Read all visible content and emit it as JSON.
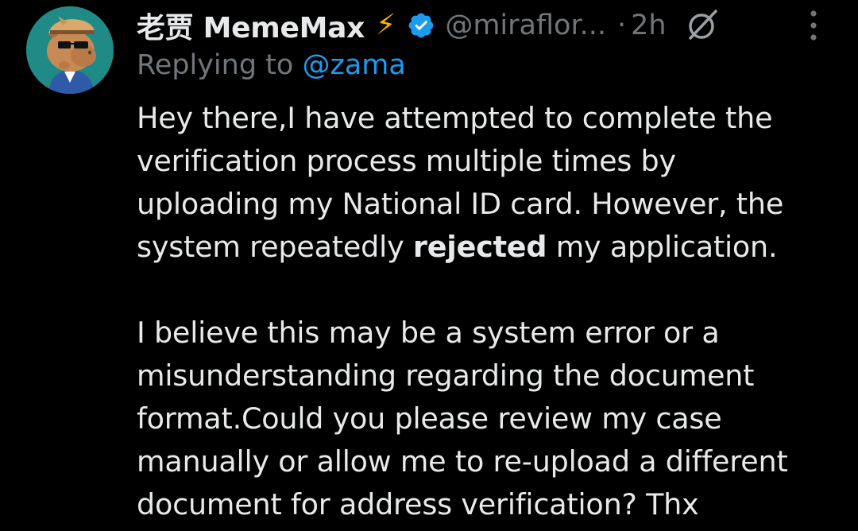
{
  "author": {
    "name": "老贾 MemeMax",
    "emoji": "⚡",
    "handle": "@miraflor...",
    "separator": "·",
    "time": "2h",
    "avatar_bg": "#1f8a86"
  },
  "reply": {
    "prefix": "Replying to ",
    "mention": "@zama"
  },
  "body": {
    "lines1": [
      "Hey there,I have attempted to complete the",
      "verification process multiple times by",
      "uploading my National ID card. However, the"
    ],
    "line4_pre": "system repeatedly ",
    "line4_bold": "rejected",
    "line4_post": " my application.",
    "lines2": [
      "I believe this may be a system error or a",
      "misunderstanding regarding the document",
      "format.Could you please review my case",
      "manually or allow me to re-upload a different",
      "document for address verification? Thx"
    ]
  },
  "icons": {
    "verified": "verified-badge-icon",
    "grok": "grok-icon",
    "more": "more-vertical-icon"
  },
  "colors": {
    "background": "#000000",
    "text": "#e7e9ea",
    "muted": "#71767b",
    "accent": "#1d9bf0",
    "bolt": "#f7b500"
  }
}
